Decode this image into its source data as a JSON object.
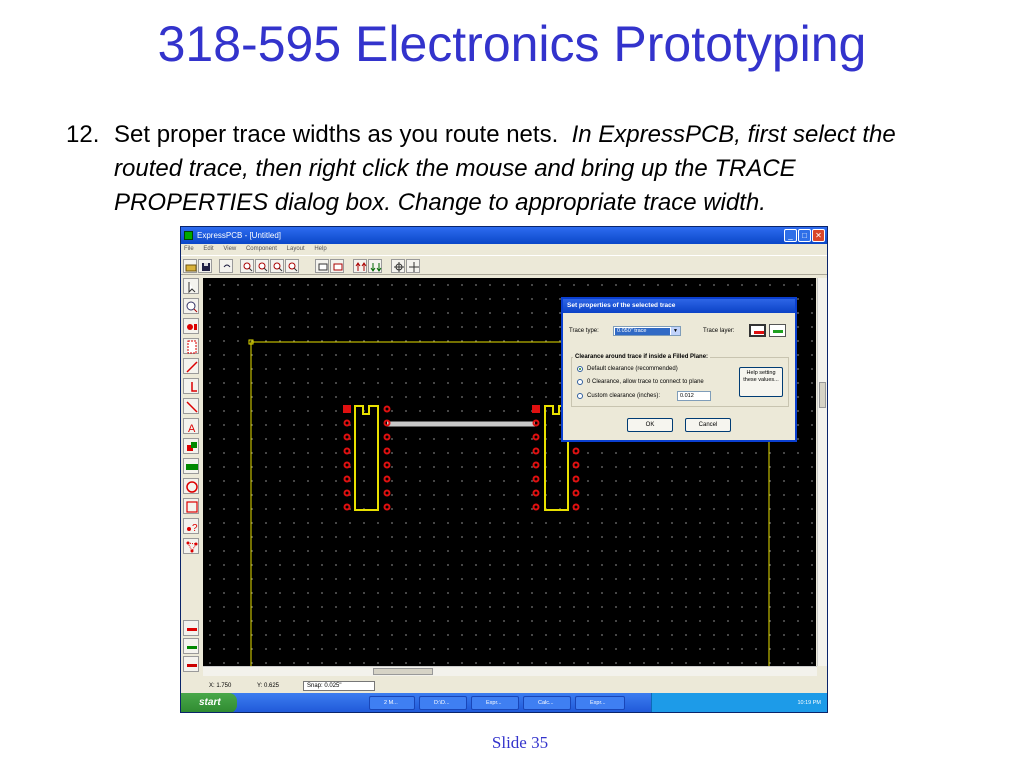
{
  "slide": {
    "title": "318-595 Electronics Prototyping",
    "bullet_number": "12.",
    "bullet_text_plain": "Set proper trace widths as you route nets.",
    "bullet_text_italic": "In ExpressPCB, first select the routed trace, then right click the mouse and bring up the TRACE PROPERTIES dialog box.  Change to appropriate trace width.",
    "footer": "Slide 35"
  },
  "window": {
    "title": "ExpressPCB - [Untitled]",
    "menu": [
      "File",
      "Edit",
      "View",
      "Component",
      "Layout",
      "Help"
    ],
    "controls": {
      "minimize": "_",
      "maximize": "□",
      "close": "✕"
    }
  },
  "toolbar_icons": [
    "open-icon",
    "save-icon",
    "undo-icon",
    "zoom-in-icon",
    "zoom-out-icon",
    "zoom-area-icon",
    "zoom-fit-icon",
    "properties-icon",
    "move-icon",
    "pan-icon"
  ],
  "left_tool_icons": [
    "pointer-icon",
    "zoom-tool-icon",
    "pad-icon",
    "component-icon",
    "trace-icon",
    "line-icon",
    "diagonal-icon",
    "text-icon",
    "fill-icon",
    "part-icon",
    "circle-icon",
    "rectangle-icon",
    "query-icon",
    "net-icon"
  ],
  "status": {
    "x": "X: 1.750",
    "y": "Y: 0.625",
    "snap": "Snap:  0.025\""
  },
  "taskbar": {
    "start": "start",
    "tasks": [
      "2 M...",
      "D:\\D...",
      "Expr...",
      "Calc...",
      "Expr..."
    ],
    "clock": "10:19 PM"
  },
  "dialog": {
    "title": "Set properties of the selected trace",
    "trace_type_label": "Trace type:",
    "trace_type_value": "0.050\" trace",
    "trace_layer_label": "Trace layer:",
    "clearance_group_title": "Clearance around trace if inside a Filled Plane:",
    "options": [
      "Default clearance (recommended)",
      "0 Clearance, allow trace to connect to plane",
      "Custom clearance (inches):"
    ],
    "selected_option": 0,
    "custom_clearance_value": "0.012",
    "help_button": "Help setting these values...",
    "ok": "OK",
    "cancel": "Cancel"
  },
  "colors": {
    "title_blue": "#3333cc",
    "canvas": "#000000",
    "outline_yellow": "#e8e000",
    "pad_red": "#e01010",
    "trace_gray": "#c8c8c8"
  }
}
